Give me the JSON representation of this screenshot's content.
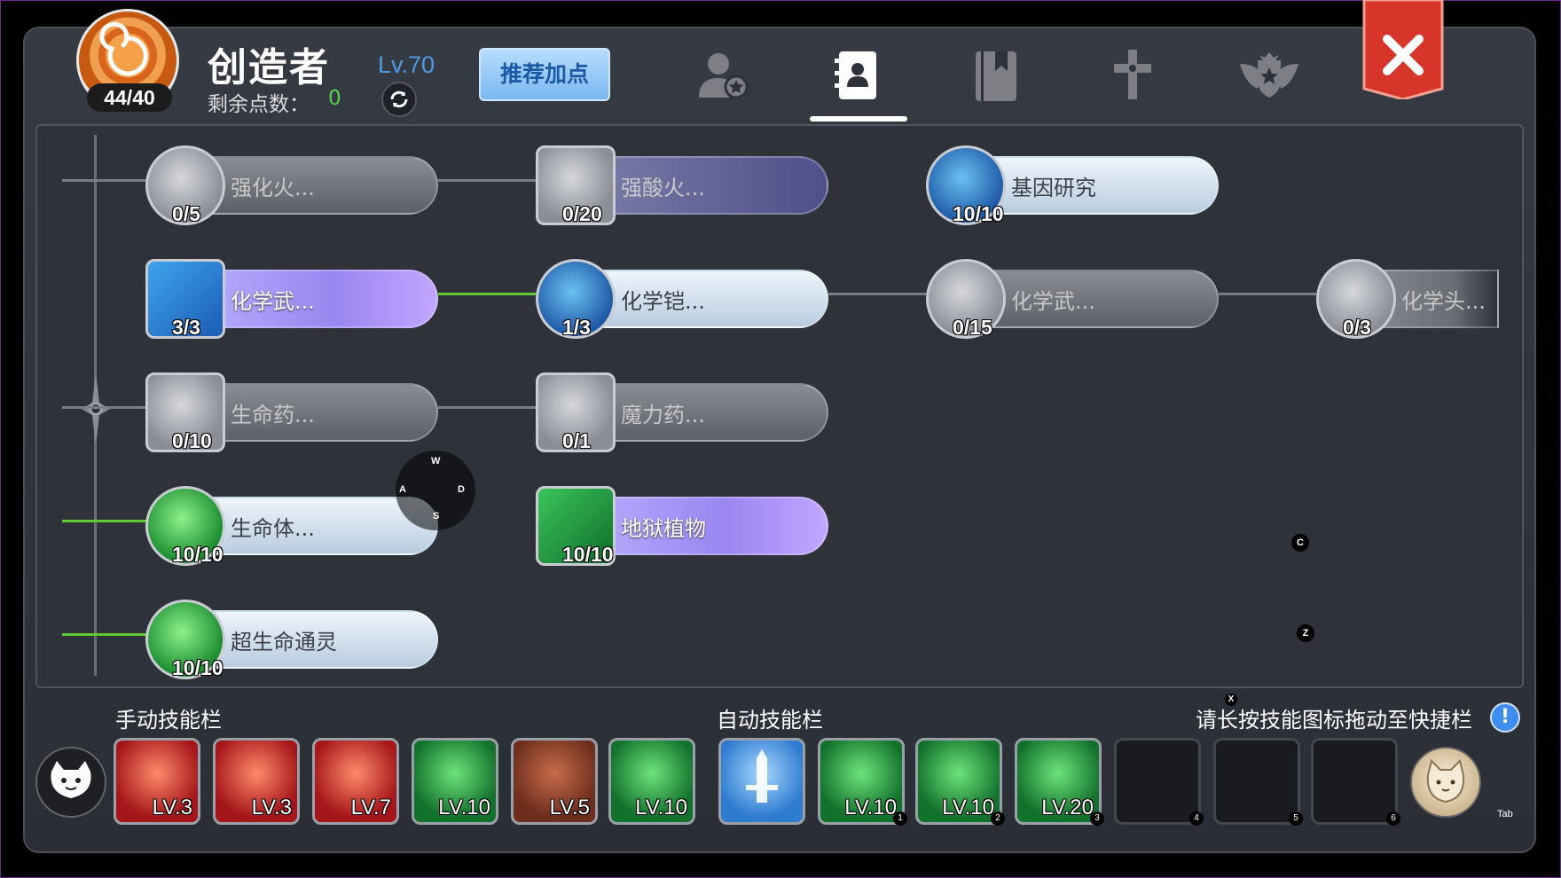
{
  "header": {
    "avatar_count": "44/40",
    "char_name": "创造者",
    "level": "Lv.70",
    "points_label": "剩余点数：",
    "points_value": "0",
    "recommend_button": "推荐加点",
    "tabs": [
      {
        "name": "character-tab",
        "icon": "person-star-icon",
        "active": false
      },
      {
        "name": "skills-tab",
        "icon": "contact-book-icon",
        "active": true
      },
      {
        "name": "codex-tab",
        "icon": "bookmark-book-icon",
        "active": false
      },
      {
        "name": "cross-tab",
        "icon": "cross-icon",
        "active": false
      },
      {
        "name": "emblem-tab",
        "icon": "winged-star-emblem-icon",
        "active": false
      }
    ]
  },
  "skills": [
    {
      "name": "强化火...",
      "count": "0/5",
      "style": "gray"
    },
    {
      "name": "强酸火...",
      "count": "0/20",
      "style": "purple"
    },
    {
      "name": "基因研究",
      "count": "10/10",
      "style": "light"
    },
    {
      "name": "化学武...",
      "count": "3/3",
      "style": "violet"
    },
    {
      "name": "化学铠...",
      "count": "1/3",
      "style": "light"
    },
    {
      "name": "化学武...",
      "count": "0/15",
      "style": "gray"
    },
    {
      "name": "化学头...",
      "count": "0/3",
      "style": "gray"
    },
    {
      "name": "生命药...",
      "count": "0/10",
      "style": "gray"
    },
    {
      "name": "魔力药...",
      "count": "0/1",
      "style": "gray"
    },
    {
      "name": "生命体...",
      "count": "10/10",
      "style": "light"
    },
    {
      "name": "地狱植物",
      "count": "10/10",
      "style": "violet"
    },
    {
      "name": "超生命通灵",
      "count": "10/10",
      "style": "light"
    }
  ],
  "joystick": {
    "w": "W",
    "a": "A",
    "s": "S",
    "d": "D"
  },
  "key_hints": {
    "c": "C",
    "z": "Z",
    "x": "X",
    "tab": "Tab"
  },
  "bottom": {
    "manual_label": "手动技能栏",
    "auto_label": "自动技能栏",
    "hint": "请长按技能图标拖动至快捷栏",
    "info_icon": "!",
    "manual_slots": [
      {
        "lv": "LV.3",
        "color": "red"
      },
      {
        "lv": "LV.3",
        "color": "red"
      },
      {
        "lv": "LV.7",
        "color": "red"
      },
      {
        "lv": "LV.10",
        "color": "green"
      },
      {
        "lv": "LV.5",
        "color": "brown"
      },
      {
        "lv": "LV.10",
        "color": "green"
      }
    ],
    "auto_slots": [
      {
        "lv": "",
        "color": "blue",
        "num": ""
      },
      {
        "lv": "LV.10",
        "color": "green",
        "num": "1"
      },
      {
        "lv": "LV.10",
        "color": "green",
        "num": "2"
      },
      {
        "lv": "LV.20",
        "color": "green",
        "num": "3"
      },
      {
        "lv": "",
        "color": "empty",
        "num": "4"
      },
      {
        "lv": "",
        "color": "empty",
        "num": "5"
      },
      {
        "lv": "",
        "color": "empty",
        "num": "6"
      }
    ]
  }
}
